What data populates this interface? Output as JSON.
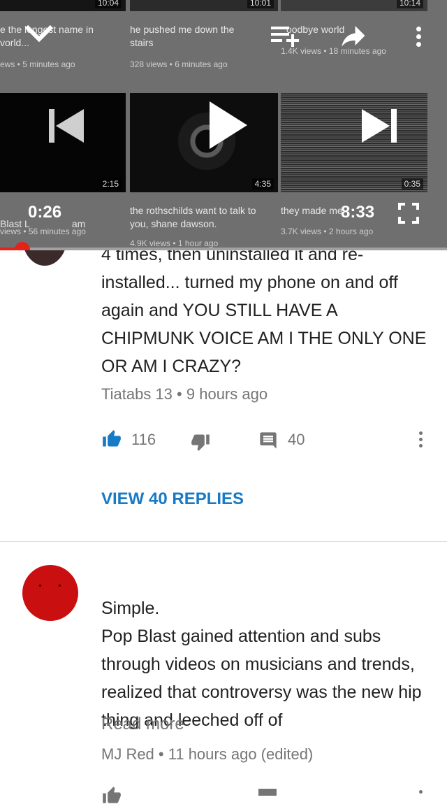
{
  "player": {
    "elapsed": "0:26",
    "duration": "8:33",
    "progress": 0.05,
    "top_row": [
      {
        "duration": "10:04",
        "title": "e the longest name in\nvorld...",
        "meta": "ews • 5 minutes ago"
      },
      {
        "duration": "10:01",
        "title": "he pushed me down the\nstairs",
        "meta": "328 views • 6 minutes ago"
      },
      {
        "duration": "10:14",
        "title": "oodbye world",
        "meta": "1.4K views • 18 minutes ago"
      }
    ],
    "bottom_row": [
      {
        "duration": "2:15",
        "title": "Blast L",
        "title_tail": "am",
        "meta": "views • 56 minutes ago"
      },
      {
        "duration": "4:35",
        "title": "the rothschilds want to talk to\nyou, shane dawson.",
        "meta": "4.9K views • 1 hour ago"
      },
      {
        "duration": "0:35",
        "title": "they made me",
        "meta": "3.7K views • 2 hours ago"
      }
    ]
  },
  "comment1": {
    "text": "4 times, then uninstalled it and re-installed... turned my phone on and off again and YOU STILL HAVE A CHIPMUNK VOICE AM I THE ONLY ONE OR AM I CRAZY?",
    "author": "Tiatabs 13",
    "time": "9 hours ago",
    "likes": "116",
    "replies_count": "40",
    "view_replies": "VIEW 40 REPLIES"
  },
  "comment2": {
    "text": "Simple.\nPop Blast gained attention and subs through videos on musicians and trends, realized that controversy was the new hip thing and leeched off of",
    "read_more": "Read more",
    "author": "MJ Red",
    "time": "11 hours ago (edited)"
  },
  "colors": {
    "accent": "#167ac6",
    "progress": "#e62117",
    "avatar": "#c90f0f"
  }
}
